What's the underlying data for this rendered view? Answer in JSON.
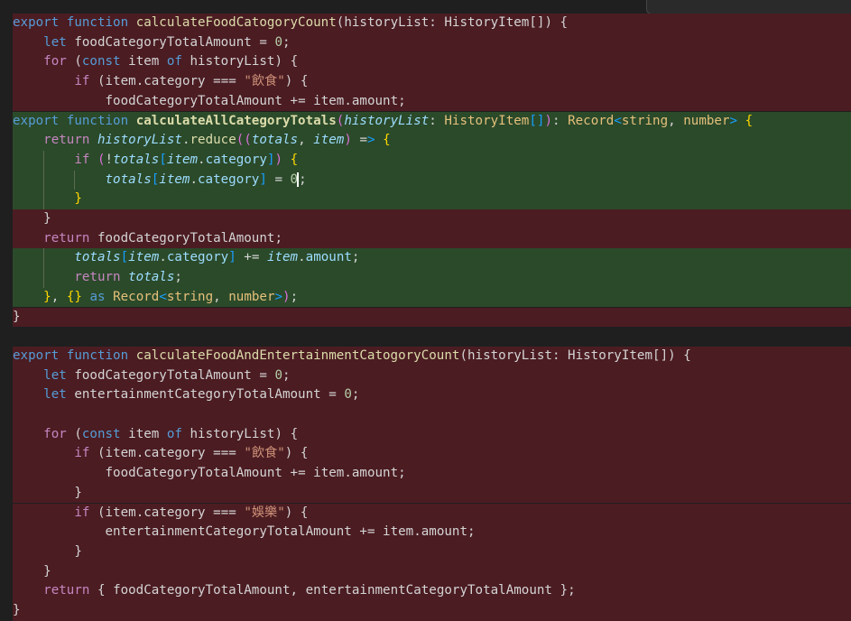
{
  "editor": {
    "lines": [
      {
        "type": "del",
        "text": "export function calculateFoodCatogoryCount(historyList: HistoryItem[]) {"
      },
      {
        "type": "del",
        "text": "    let foodCategoryTotalAmount = 0;"
      },
      {
        "type": "del",
        "text": "    for (const item of historyList) {"
      },
      {
        "type": "del",
        "text": "        if (item.category === \"飲食\") {"
      },
      {
        "type": "del",
        "text": "            foodCategoryTotalAmount += item.amount;"
      },
      {
        "type": "add",
        "text": "export function calculateAllCategoryTotals(historyList: HistoryItem[]): Record<string, number> {"
      },
      {
        "type": "add",
        "text": "    return historyList.reduce((totals, item) => {"
      },
      {
        "type": "add",
        "text": "        if (!totals[item.category]) {"
      },
      {
        "type": "add",
        "text": "            totals[item.category] = 0;"
      },
      {
        "type": "add",
        "text": "        }"
      },
      {
        "type": "del",
        "text": "    }"
      },
      {
        "type": "del",
        "text": "    return foodCategoryTotalAmount;"
      },
      {
        "type": "add",
        "text": "        totals[item.category] += item.amount;"
      },
      {
        "type": "add",
        "text": "        return totals;"
      },
      {
        "type": "add",
        "text": "    }, {} as Record<string, number>);"
      },
      {
        "type": "del",
        "text": "}"
      },
      {
        "type": "blank",
        "text": ""
      },
      {
        "type": "del",
        "text": "export function calculateFoodAndEntertainmentCatogoryCount(historyList: HistoryItem[]) {"
      },
      {
        "type": "del",
        "text": "    let foodCategoryTotalAmount = 0;"
      },
      {
        "type": "del",
        "text": "    let entertainmentCategoryTotalAmount = 0;"
      },
      {
        "type": "del",
        "text": ""
      },
      {
        "type": "del",
        "text": "    for (const item of historyList) {"
      },
      {
        "type": "del",
        "text": "        if (item.category === \"飲食\") {"
      },
      {
        "type": "del",
        "text": "            foodCategoryTotalAmount += item.amount;"
      },
      {
        "type": "del",
        "text": "        }"
      },
      {
        "type": "del",
        "text": "        if (item.category === \"娛樂\") {"
      },
      {
        "type": "del",
        "text": "            entertainmentCategoryTotalAmount += item.amount;"
      },
      {
        "type": "del",
        "text": "        }"
      },
      {
        "type": "del",
        "text": "    }"
      },
      {
        "type": "del",
        "text": "    return { foodCategoryTotalAmount, entertainmentCategoryTotalAmount };"
      },
      {
        "type": "del",
        "text": "}"
      }
    ]
  },
  "colors": {
    "deleted_bg": "#4b1c22",
    "added_bg": "#2b4a2a",
    "editor_bg": "#1f1f1f"
  }
}
